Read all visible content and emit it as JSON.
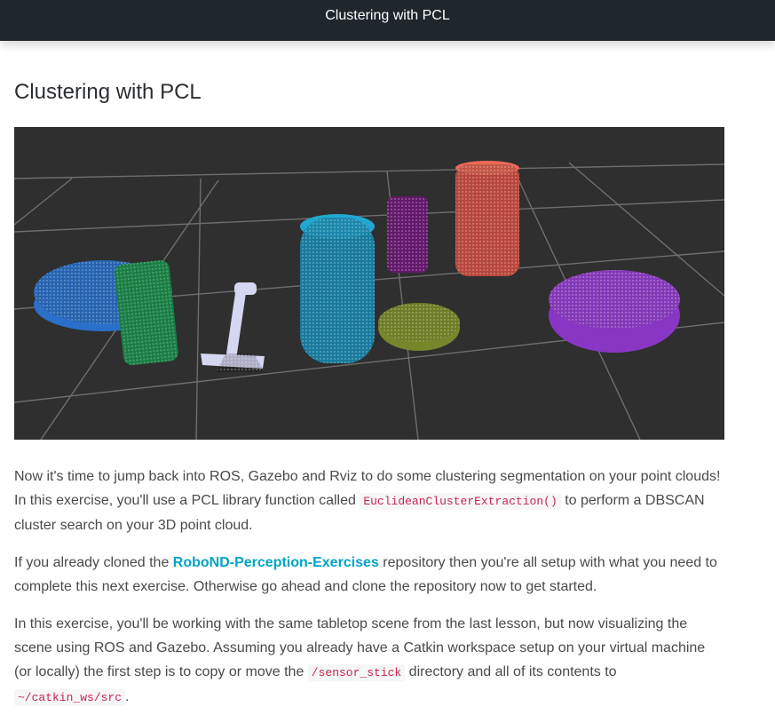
{
  "header": {
    "title": "Clustering with PCL"
  },
  "page": {
    "heading": "Clustering with PCL"
  },
  "figure": {
    "description_icon": "point-cloud-clusters",
    "colors": [
      "#2a78d6",
      "#1f9a52",
      "#cfd3f5",
      "#1e9ac4",
      "#7a1f84",
      "#e25a48",
      "#7f8f2a",
      "#9a3fd8"
    ]
  },
  "para1": {
    "t1": "Now it's time to jump back into ROS, Gazebo and Rviz to do some clustering segmentation on your point clouds! In this exercise, you'll use a PCL library function called ",
    "code1": "EuclideanClusterExtraction()",
    "t2": " to perform a DBSCAN cluster search on your 3D point cloud."
  },
  "para2": {
    "t1": "If you already cloned the ",
    "link": "RoboND-Perception-Exercises",
    "t2": " repository then you're all setup with what you need to complete this next exercise. Otherwise go ahead and clone the repository now to get started."
  },
  "para3": {
    "t1": "In this exercise, you'll be working with the same tabletop scene from the last lesson, but now visualizing the scene using ROS and Gazebo. Assuming you already have a Catkin workspace setup on your virtual machine (or locally) the first step is to copy or move the ",
    "code1": "/sensor_stick",
    "t2": " directory and all of its contents to ",
    "code2": "~/catkin_ws/src",
    "t3": "."
  }
}
